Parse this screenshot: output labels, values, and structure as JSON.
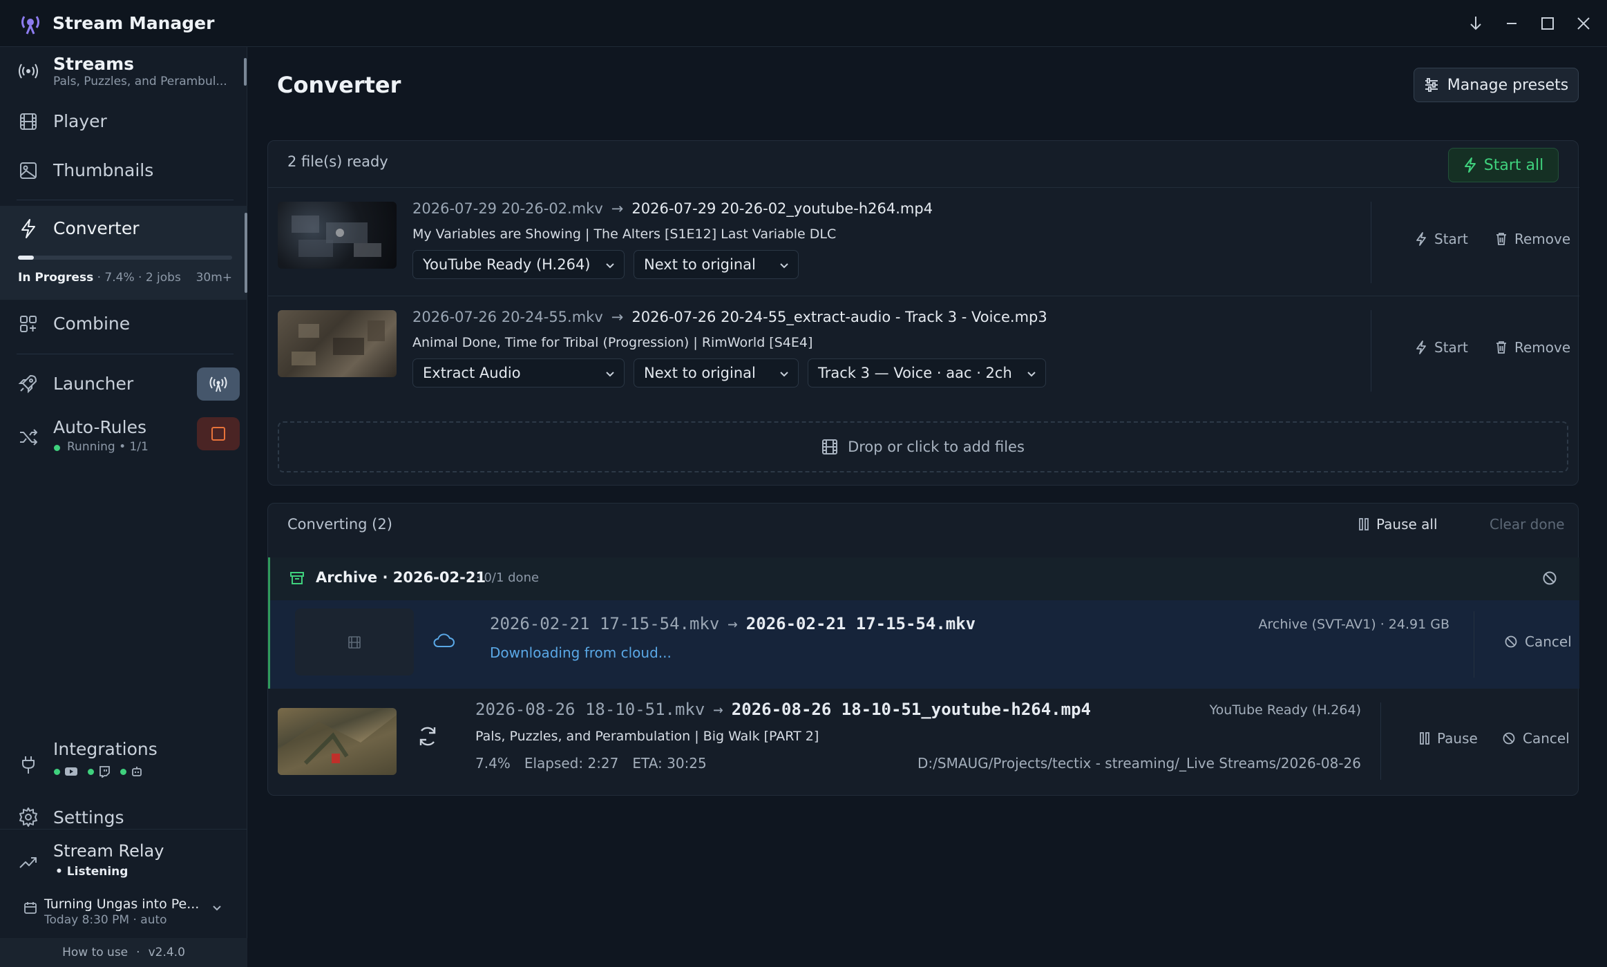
{
  "app": {
    "title": "Stream Manager"
  },
  "sidebar": {
    "streams": {
      "label": "Streams",
      "sub": "Pals, Puzzles, and Perambul..."
    },
    "player": {
      "label": "Player"
    },
    "thumbnails": {
      "label": "Thumbnails"
    },
    "converter": {
      "label": "Converter",
      "status_label": "In Progress",
      "status_detail": "· 7.4% · 2 jobs",
      "eta": "30m+",
      "progress": 0.074
    },
    "combine": {
      "label": "Combine"
    },
    "launcher": {
      "label": "Launcher"
    },
    "autorules": {
      "label": "Auto-Rules",
      "status": "Running • 1/1"
    },
    "integrations": {
      "label": "Integrations"
    },
    "settings": {
      "label": "Settings"
    },
    "relay": {
      "label": "Stream Relay",
      "status": "• Listening"
    },
    "schedule": {
      "title": "Turning Ungas into Pe...",
      "time": "Today 8:30 PM · auto"
    },
    "footer": {
      "help": "How to use",
      "sep": "·",
      "version": "v2.4.0"
    }
  },
  "main": {
    "title": "Converter",
    "manage_presets": "Manage presets",
    "ready": {
      "heading": "2 file(s) ready",
      "start_all": "Start all",
      "files": [
        {
          "src": "2026-07-29 20-26-02.mkv",
          "arrow": "→",
          "dst": "2026-07-29 20-26-02_youtube-h264.mp4",
          "title": "My Variables are Showing | The Alters [S1E12] Last Variable DLC",
          "preset": "YouTube Ready (H.264)",
          "location": "Next to original",
          "start": "Start",
          "remove": "Remove"
        },
        {
          "src": "2026-07-26 20-24-55.mkv",
          "arrow": "→",
          "dst": "2026-07-26 20-24-55_extract-audio - Track 3 - Voice.mp3",
          "title": "Animal Done, Time for Tribal (Progression) | RimWorld [S4E4]",
          "preset": "Extract Audio",
          "location": "Next to original",
          "track": "Track 3 — Voice · aac · 2ch",
          "start": "Start",
          "remove": "Remove"
        }
      ],
      "dropzone": "Drop or click to add files"
    },
    "converting": {
      "heading": "Converting (2)",
      "pause_all": "Pause all",
      "clear_done": "Clear done",
      "group": {
        "name": "Archive · 2026-02-21",
        "progress": "· 0/1 done"
      },
      "job1": {
        "src": "2026-02-21 17-15-54.mkv",
        "arrow": "→",
        "dst": "2026-02-21 17-15-54.mkv",
        "status": "Downloading from cloud...",
        "preset": "Archive (SVT-AV1) · 24.91 GB",
        "cancel": "Cancel"
      },
      "job2": {
        "src": "2026-08-26 18-10-51.mkv",
        "arrow": "→",
        "dst": "2026-08-26 18-10-51_youtube-h264.mp4",
        "title": "Pals, Puzzles, and Perambulation | Big Walk [PART 2]",
        "percent": "7.4%",
        "elapsed": "Elapsed: 2:27",
        "eta": "ETA: 30:25",
        "path": "D:/SMAUG/Projects/tectix - streaming/_Live Streams/2026-08-26",
        "preset": "YouTube Ready (H.264)",
        "pause": "Pause",
        "cancel": "Cancel"
      }
    }
  },
  "colors": {
    "accent_green": "#3fd17d",
    "accent_blue": "#5aa8e6",
    "danger_orange": "#e8733a",
    "purple": "#8d7cf0"
  }
}
